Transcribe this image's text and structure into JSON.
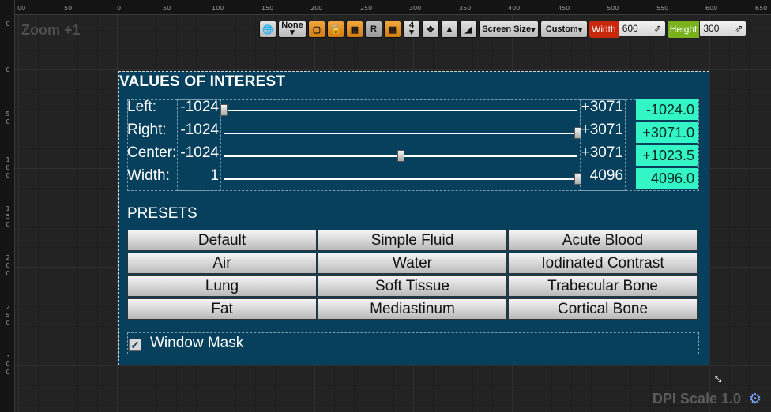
{
  "ruler": {
    "top_ticks": [
      "00",
      "50",
      "0",
      "50",
      "100",
      "150",
      "200",
      "250",
      "300",
      "350",
      "400",
      "450",
      "500",
      "550",
      "600",
      "650"
    ],
    "left_ticks": [
      "0",
      "0",
      "5\n0",
      "1\n0\n0",
      "1\n5\n0",
      "2\n0\n0",
      "2\n5\n0",
      "3\n0\n0"
    ]
  },
  "canvas": {
    "zoom": "Zoom +1",
    "dpi_scale": "DPI Scale 1.0"
  },
  "toolbar": {
    "language_icon": "globe-icon",
    "none_label": "None",
    "r_label": "R",
    "grid_snap_value": "4",
    "screen_size_label": "Screen Size",
    "custom_label": "Custom",
    "width_label": "Width",
    "width_value": "600",
    "height_label": "Height",
    "height_value": "300",
    "colors": {
      "orange": "#e8961f",
      "width_red": "#c8280c",
      "height_green": "#7ab21e"
    }
  },
  "panel": {
    "title": "VALUES OF INTEREST",
    "rows": [
      {
        "label": "Left:",
        "min": "-1024",
        "max": "+3071",
        "fraction": 0.0,
        "value": "-1024.0"
      },
      {
        "label": "Right:",
        "min": "-1024",
        "max": "+3071",
        "fraction": 1.0,
        "value": "+3071.0"
      },
      {
        "label": "Center:",
        "min": "-1024",
        "max": "+3071",
        "fraction": 0.5,
        "value": "+1023.5"
      },
      {
        "label": "Width:",
        "min": "1",
        "max": "4096",
        "fraction": 1.0,
        "value": "4096.0"
      }
    ],
    "presets_title": "PRESETS",
    "presets": [
      [
        "Default",
        "Simple Fluid",
        "Acute Blood"
      ],
      [
        "Air",
        "Water",
        "Iodinated Contrast"
      ],
      [
        "Lung",
        "Soft Tissue",
        "Trabecular Bone"
      ],
      [
        "Fat",
        "Mediastinum",
        "Cortical Bone"
      ]
    ],
    "window_mask_label": "Window Mask",
    "window_mask_checked": true,
    "colors": {
      "panel_bg": "#06405d",
      "value_box": "#33f5c6"
    }
  }
}
